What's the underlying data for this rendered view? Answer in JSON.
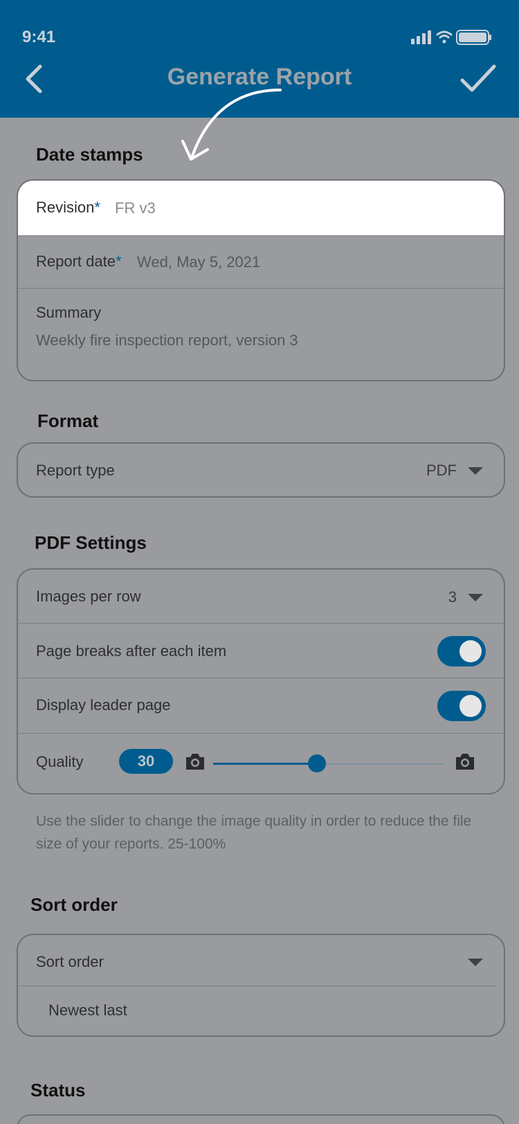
{
  "status_bar": {
    "time": "9:41"
  },
  "header": {
    "title": "Generate Report"
  },
  "icons": {
    "back": "chevron-left-icon",
    "confirm": "checkmark-icon",
    "camera": "camera-icon",
    "dropdown": "caret-down-icon"
  },
  "colors": {
    "header_bg": "#005c8e",
    "accent": "#005c8e",
    "overlay_bg": "#999b9e",
    "highlight_row_bg": "#ffffff"
  },
  "date_stamps": {
    "heading": "Date stamps",
    "revision_label": "Revision",
    "revision_value": "FR v3",
    "report_date_label": "Report date",
    "report_date_value": "Wed, May 5, 2021",
    "summary_label": "Summary",
    "summary_value": "Weekly fire inspection report, version 3",
    "required_mark": "*"
  },
  "format": {
    "heading": "Format",
    "report_type_label": "Report type",
    "report_type_value": "PDF"
  },
  "pdf_settings": {
    "heading": "PDF Settings",
    "images_per_row_label": "Images per row",
    "images_per_row_value": "3",
    "page_breaks_label": "Page breaks after each item",
    "page_breaks_on": true,
    "leader_page_label": "Display leader page",
    "leader_page_on": true,
    "quality_label": "Quality",
    "quality_value": "30",
    "quality_slider_fraction": 0.45
  },
  "help": {
    "text": "Use the slider to change the image quality in order to reduce the file size of your reports. 25-100%"
  },
  "sort": {
    "heading": "Sort order",
    "field_label": "Sort order",
    "selected": "Newest last"
  },
  "status": {
    "heading": "Status"
  }
}
